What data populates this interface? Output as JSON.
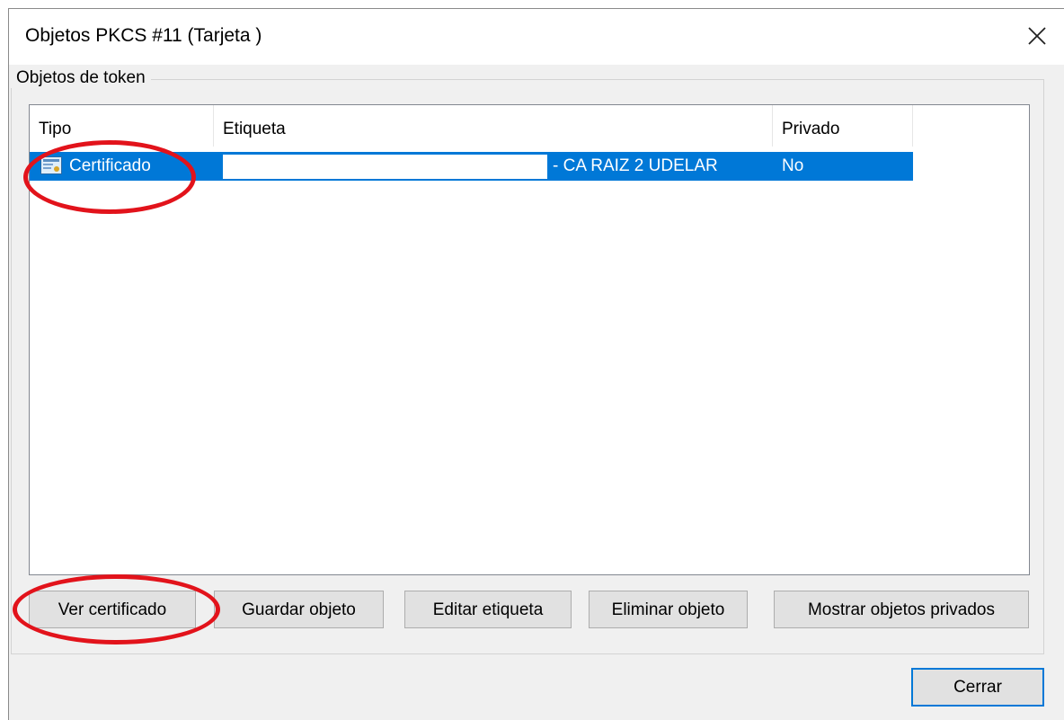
{
  "window": {
    "title": "Objetos PKCS #11 (Tarjeta        )",
    "close_icon": "close-icon"
  },
  "group": {
    "label": "Objetos de token"
  },
  "table": {
    "columns": [
      "Tipo",
      "Etiqueta",
      "Privado"
    ],
    "rows": [
      {
        "tipo": "Certificado",
        "etiqueta": "- CA RAIZ 2 UDELAR",
        "privado": "No",
        "icon": "certificate-icon",
        "selected": true
      }
    ]
  },
  "buttons": {
    "ver_certificado": "Ver certificado",
    "guardar_objeto": "Guardar objeto",
    "editar_etiqueta": "Editar etiqueta",
    "eliminar_objeto": "Eliminar objeto",
    "mostrar_privados": "Mostrar objetos privados",
    "cerrar": "Cerrar"
  },
  "colors": {
    "selection": "#0078d7",
    "annotation": "#e2131b",
    "window_bg": "#f0f0f0"
  }
}
